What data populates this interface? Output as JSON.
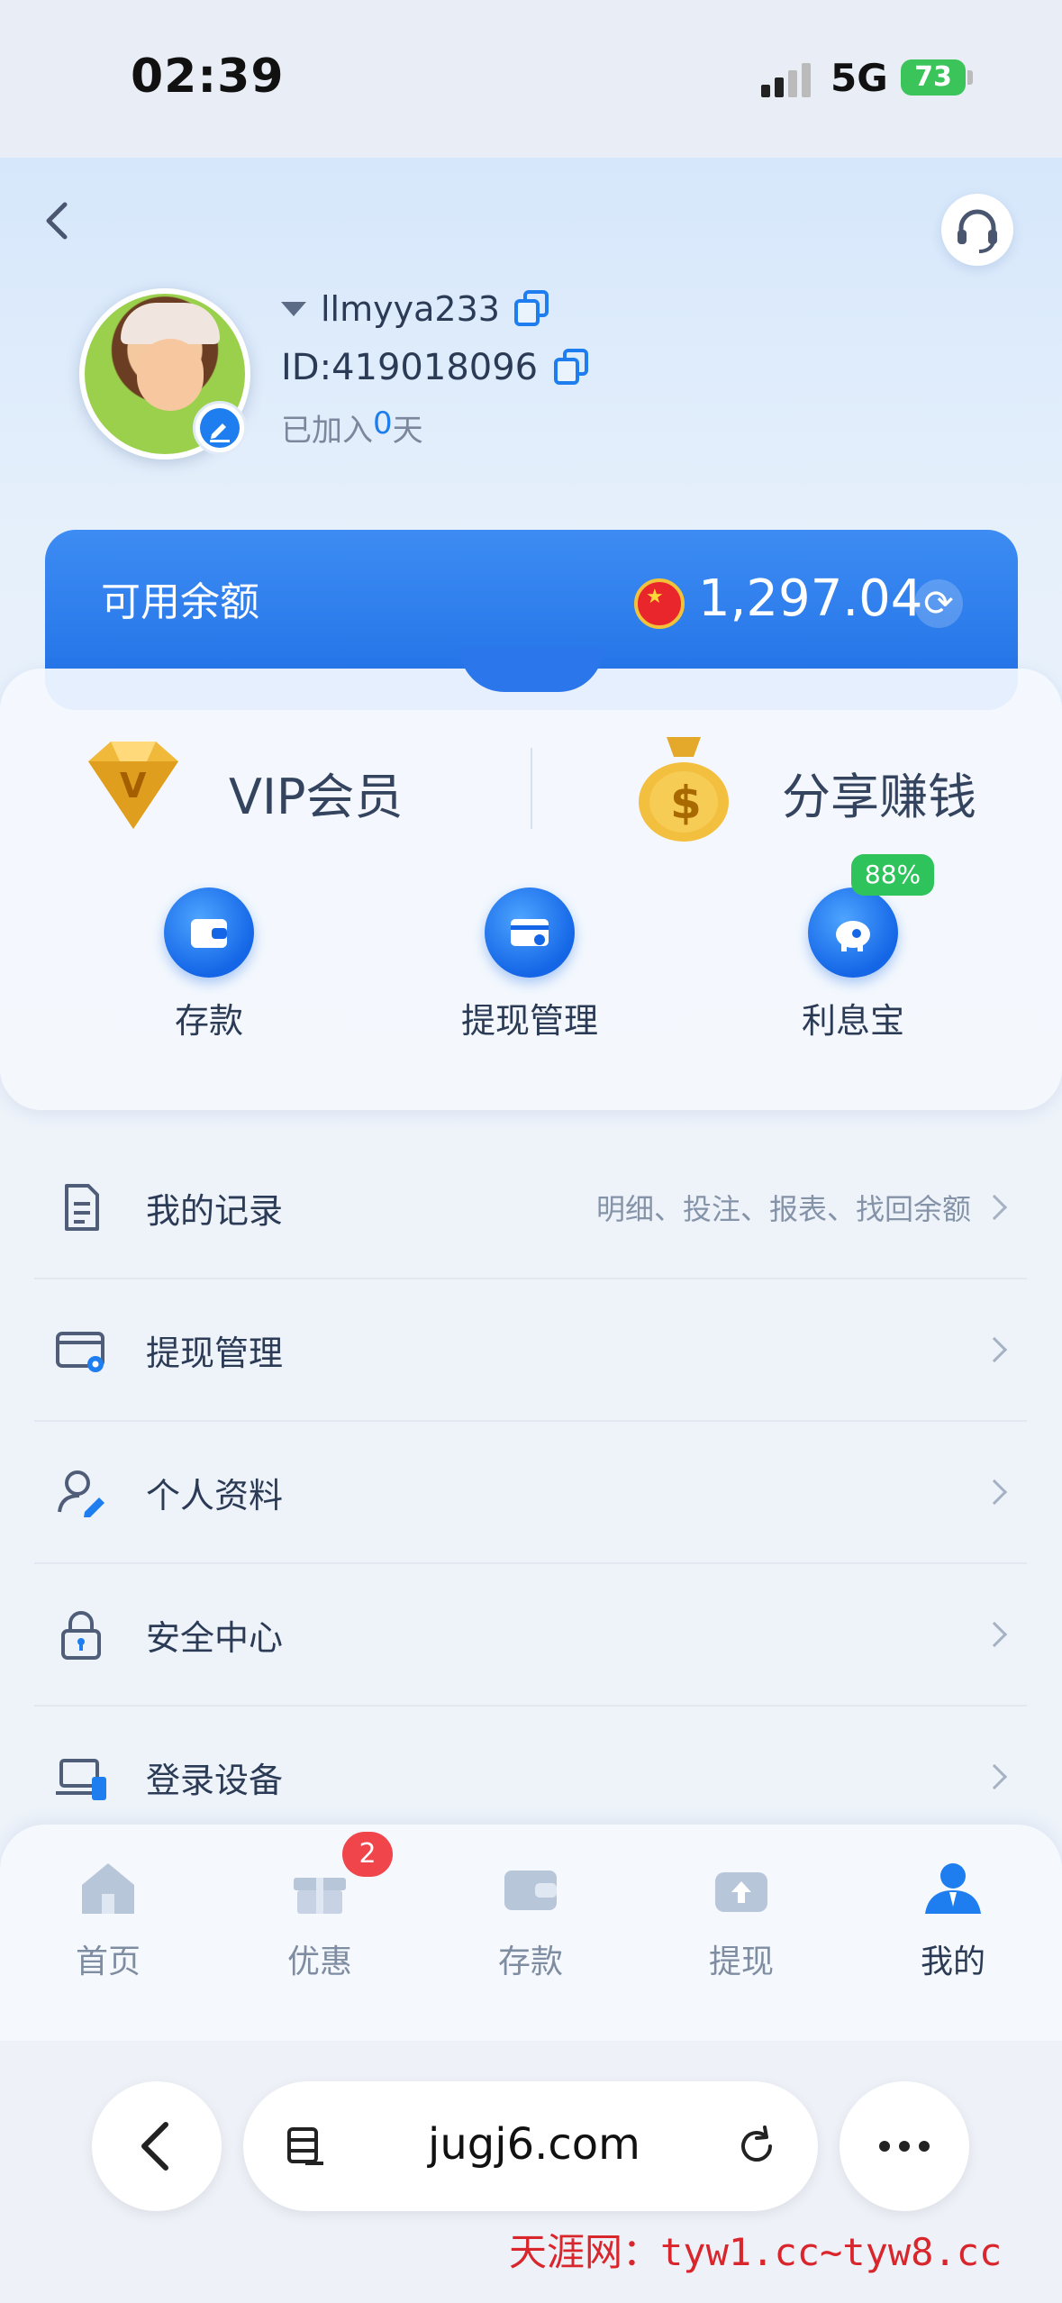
{
  "status_bar": {
    "time": "02:39",
    "network": "5G",
    "battery": "73"
  },
  "profile": {
    "username": "llmyya233",
    "id": "ID:419018096",
    "joined_prefix": "已加入",
    "joined_days": "0",
    "joined_suffix": "天"
  },
  "balance": {
    "label": "可用余额",
    "amount": "1,297.04"
  },
  "features": {
    "vip": "VIP会员",
    "share": "分享赚钱"
  },
  "quick_actions": [
    {
      "label": "存款"
    },
    {
      "label": "提现管理"
    },
    {
      "label": "利息宝",
      "badge": "88%"
    }
  ],
  "menu": [
    {
      "label": "我的记录",
      "hint": "明细、投注、报表、找回余额"
    },
    {
      "label": "提现管理",
      "hint": ""
    },
    {
      "label": "个人资料",
      "hint": ""
    },
    {
      "label": "安全中心",
      "hint": ""
    },
    {
      "label": "登录设备",
      "hint": ""
    }
  ],
  "tabbar": {
    "items": [
      {
        "label": "首页"
      },
      {
        "label": "优惠",
        "badge": "2"
      },
      {
        "label": "存款"
      },
      {
        "label": "提现"
      },
      {
        "label": "我的"
      }
    ],
    "active_color": "#1e7ef0",
    "inactive_color": "#b8c6da"
  },
  "browser": {
    "url": "jugj6.com"
  },
  "watermark": {
    "site": "天涯网：",
    "urls": "tyw1.cc~tyw8.cc"
  },
  "colors": {
    "accent": "#1e7ef0",
    "badge_green": "#2fc35b",
    "badge_red": "#f0454b"
  }
}
